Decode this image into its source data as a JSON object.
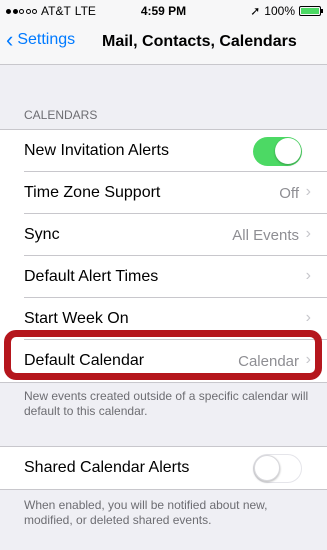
{
  "status_bar": {
    "carrier": "AT&T",
    "network": "LTE",
    "time": "4:59 PM",
    "battery": "100%",
    "signal_dots_filled": 2,
    "signal_dots_total": 5
  },
  "nav": {
    "back_label": "Settings",
    "title": "Mail, Contacts, Calendars"
  },
  "calendars_section": {
    "header": "CALENDARS",
    "rows": [
      {
        "label": "New Invitation Alerts",
        "type": "toggle",
        "state": "on"
      },
      {
        "label": "Time Zone Support",
        "value": "Off"
      },
      {
        "label": "Sync",
        "value": "All Events"
      },
      {
        "label": "Default Alert Times",
        "value": ""
      },
      {
        "label": "Start Week On",
        "value": ""
      },
      {
        "label": "Default Calendar",
        "value": "Calendar"
      }
    ],
    "footer": "New events created outside of a specific calendar will default to this calendar."
  },
  "shared_section": {
    "rows": [
      {
        "label": "Shared Calendar Alerts",
        "type": "toggle",
        "state": "off"
      }
    ],
    "footer": "When enabled, you will be notified about new, modified, or deleted shared events."
  },
  "colors": {
    "accent": "#007aff",
    "toggle_on": "#4cd964",
    "highlight": "#b5161d"
  }
}
